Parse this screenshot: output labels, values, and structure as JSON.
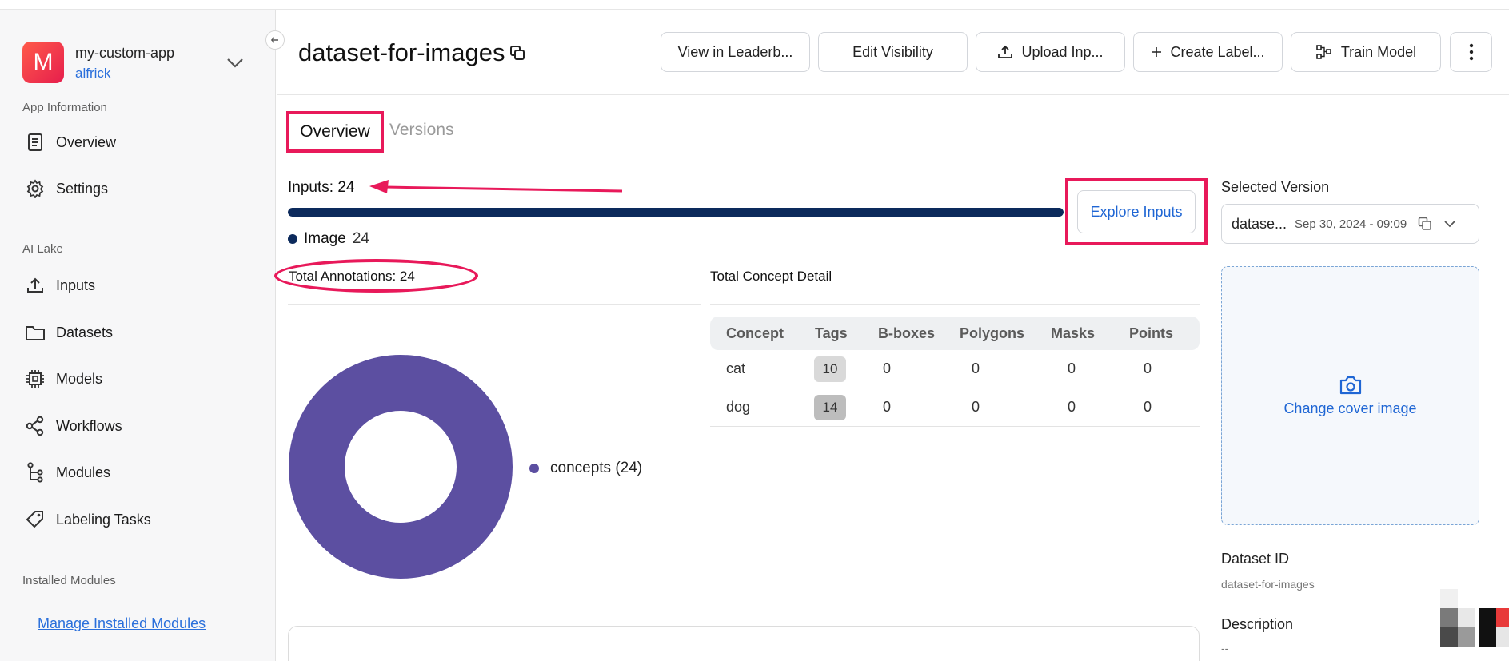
{
  "sidebar": {
    "app_logo_letter": "M",
    "app_name": "my-custom-app",
    "app_user": "alfrick",
    "sections": {
      "app_information": "App Information",
      "ai_lake": "AI Lake",
      "installed_modules": "Installed Modules"
    },
    "items": {
      "overview": "Overview",
      "settings": "Settings",
      "inputs": "Inputs",
      "datasets": "Datasets",
      "models": "Models",
      "workflows": "Workflows",
      "modules": "Modules",
      "labeling_tasks": "Labeling Tasks"
    },
    "manage_installed_modules": "Manage Installed Modules"
  },
  "header": {
    "title": "dataset-for-images",
    "buttons": {
      "view_leaderboard": "View in Leaderb...",
      "edit_visibility": "Edit Visibility",
      "upload_inputs": "Upload Inp...",
      "create_labels": "Create Label...",
      "train_model": "Train Model"
    }
  },
  "tabs": {
    "overview": "Overview",
    "versions": "Versions"
  },
  "inputs_summary": {
    "title": "Inputs: 24",
    "progress_fraction": 1.0,
    "legend_label": "Image",
    "legend_count": "24",
    "explore_button": "Explore Inputs"
  },
  "annotations": {
    "title": "Total Annotations: 24",
    "legend": "concepts (24)"
  },
  "concept_detail": {
    "title": "Total Concept Detail",
    "columns": [
      "Concept",
      "Tags",
      "B-boxes",
      "Polygons",
      "Masks",
      "Points"
    ],
    "rows": [
      {
        "concept": "cat",
        "tags": "10",
        "bboxes": "0",
        "polygons": "0",
        "masks": "0",
        "points": "0"
      },
      {
        "concept": "dog",
        "tags": "14",
        "bboxes": "0",
        "polygons": "0",
        "masks": "0",
        "points": "0"
      }
    ]
  },
  "right_panel": {
    "selected_version_label": "Selected Version",
    "version_name": "datase...",
    "version_date": "Sep 30, 2024 - 09:09",
    "change_cover": "Change cover image",
    "dataset_id_label": "Dataset ID",
    "dataset_id_value": "dataset-for-images",
    "description_label": "Description",
    "description_value": "--"
  },
  "colors": {
    "accent_blue": "#1f66d4",
    "progress_navy": "#0c2a5c",
    "donut_purple": "#5c4fa1",
    "highlight_pink": "#e8195a"
  }
}
